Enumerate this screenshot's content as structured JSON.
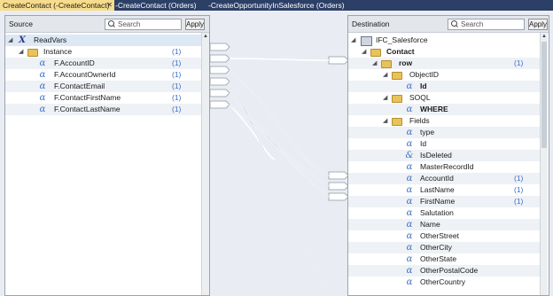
{
  "tabs": [
    {
      "label": "CreateContact (-CreateContact)",
      "close": "✕"
    },
    {
      "label": "-CreateContact (Orders)"
    },
    {
      "label": "-CreateOpportunityInSalesforce (Orders)"
    }
  ],
  "source": {
    "title": "Source",
    "search_placeholder": "Search",
    "apply_label": "Apply",
    "root": {
      "label": "ReadVars",
      "icon": "x-variable-icon"
    },
    "instance": {
      "label": "Instance",
      "count": "(1)"
    },
    "fields": [
      {
        "label": "F.AccountID",
        "count": "(1)"
      },
      {
        "label": "F.AccountOwnerId",
        "count": "(1)"
      },
      {
        "label": "F.ContactEmail",
        "count": "(1)"
      },
      {
        "label": "F.ContactFirstName",
        "count": "(1)"
      },
      {
        "label": "F.ContactLastName",
        "count": "(1)"
      }
    ]
  },
  "destination": {
    "title": "Destination",
    "search_placeholder": "Search",
    "apply_label": "Apply",
    "root": {
      "label": "IFC_Salesforce"
    },
    "contact": {
      "label": "Contact"
    },
    "row": {
      "label": "row",
      "count": "(1)"
    },
    "objectid": {
      "label": "ObjectID"
    },
    "id_bold": {
      "label": "Id"
    },
    "soql": {
      "label": "SOQL"
    },
    "where": {
      "label": "WHERE"
    },
    "fields_folder": {
      "label": "Fields"
    },
    "fields": [
      {
        "label": "type",
        "count": ""
      },
      {
        "label": "Id",
        "count": ""
      },
      {
        "label": "IsDeleted",
        "count": ""
      },
      {
        "label": "MasterRecordId",
        "count": ""
      },
      {
        "label": "AccountId",
        "count": "(1)"
      },
      {
        "label": "LastName",
        "count": "(1)"
      },
      {
        "label": "FirstName",
        "count": "(1)"
      },
      {
        "label": "Salutation",
        "count": ""
      },
      {
        "label": "Name",
        "count": ""
      },
      {
        "label": "OtherStreet",
        "count": ""
      },
      {
        "label": "OtherCity",
        "count": ""
      },
      {
        "label": "OtherState",
        "count": ""
      },
      {
        "label": "OtherPostalCode",
        "count": ""
      },
      {
        "label": "OtherCountry",
        "count": ""
      }
    ]
  },
  "colors": {
    "accent": "#3a6fc4",
    "tab_active": "#f6dc8c",
    "tab_bar": "#2c3f66"
  }
}
